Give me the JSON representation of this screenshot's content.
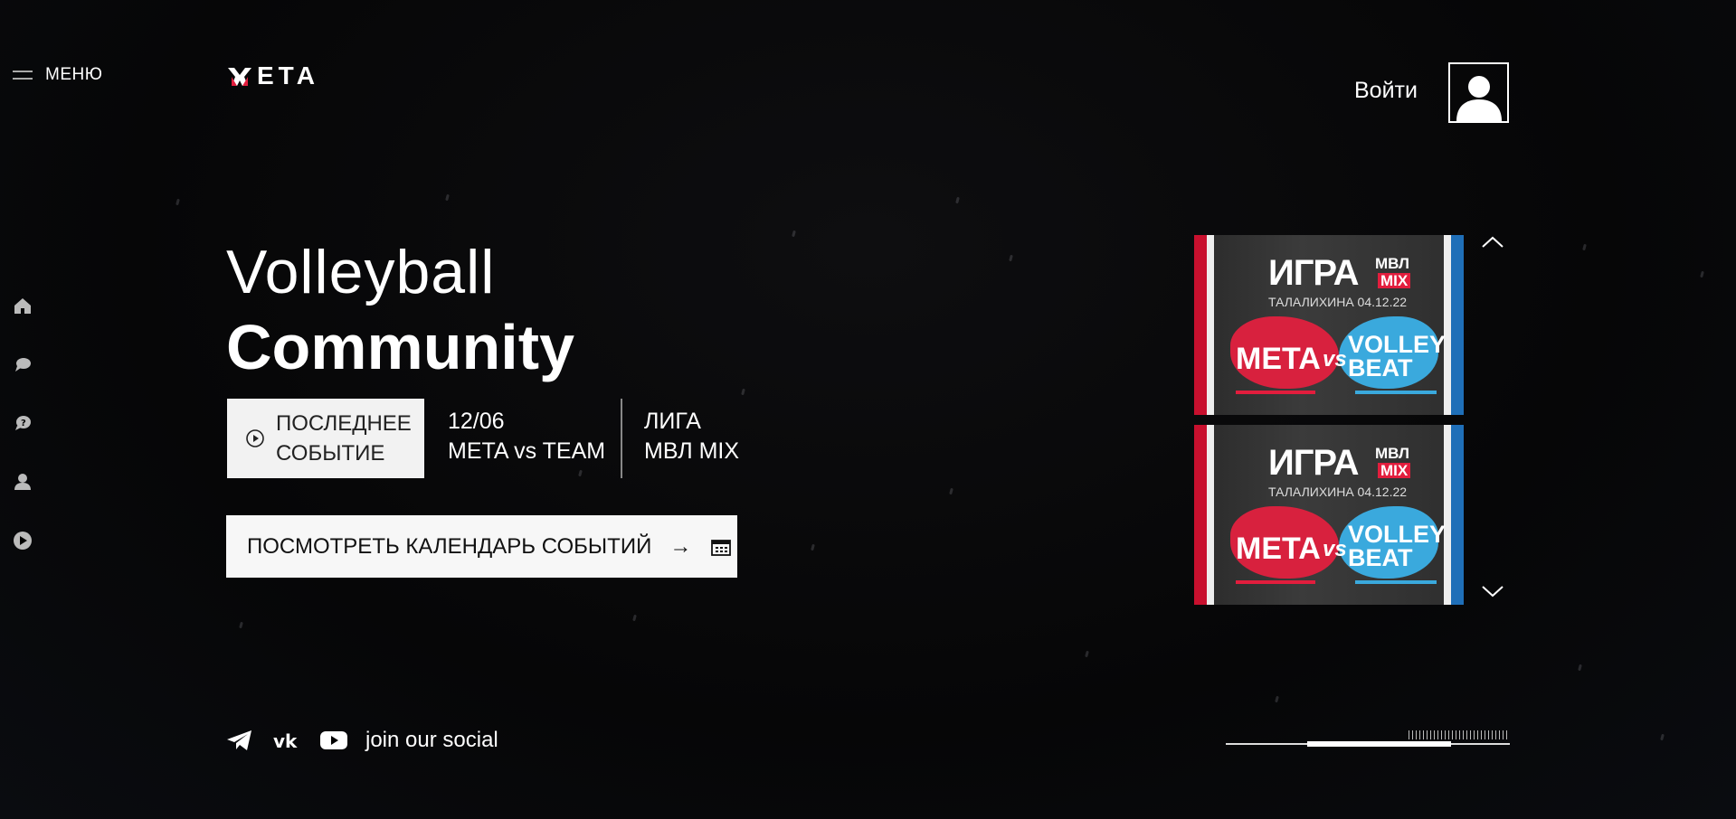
{
  "header": {
    "menu_label": "МЕНЮ",
    "logo_text": "ETA",
    "login_label": "Войти"
  },
  "sidebar": {
    "icons": [
      "home-icon",
      "chat-icon",
      "help-icon",
      "user-icon",
      "play-icon"
    ]
  },
  "hero": {
    "title_line1": "Volleyball",
    "title_line2": "Community",
    "last_event_button": [
      "ПОСЛЕДНЕЕ",
      "СОБЫТИЕ"
    ],
    "event_date": "12/06",
    "event_match": "META vs TEAM",
    "league_label": "ЛИГА",
    "league_name": "МВЛ MIX",
    "calendar_button": "ПОСМОТРЕТЬ КАЛЕНДАРЬ СОБЫТИЙ"
  },
  "carousel": {
    "posters": [
      {
        "title": "ИГРА",
        "badge_top": "МВЛ",
        "badge_bottom": "MIX",
        "subtitle": "ТАЛАЛИХИНА 04.12.22",
        "team1": "META",
        "vs": "vs",
        "team2_line1": "VOLLEY",
        "team2_line2": "BEAT"
      },
      {
        "title": "ИГРА",
        "badge_top": "МВЛ",
        "badge_bottom": "MIX",
        "subtitle": "ТАЛАЛИХИНА 04.12.22",
        "team1": "META",
        "vs": "vs",
        "team2_line1": "VOLLEY",
        "team2_line2": "BEAT"
      }
    ]
  },
  "social": {
    "icons": [
      "telegram-icon",
      "vk-icon",
      "youtube-icon"
    ],
    "label": "join our social"
  },
  "slider": {
    "progress": 0.29
  },
  "colors": {
    "accent_red": "#e21d3d",
    "accent_blue": "#3aa9dd",
    "button_bg": "#f2f2f2",
    "background": "#060607"
  }
}
